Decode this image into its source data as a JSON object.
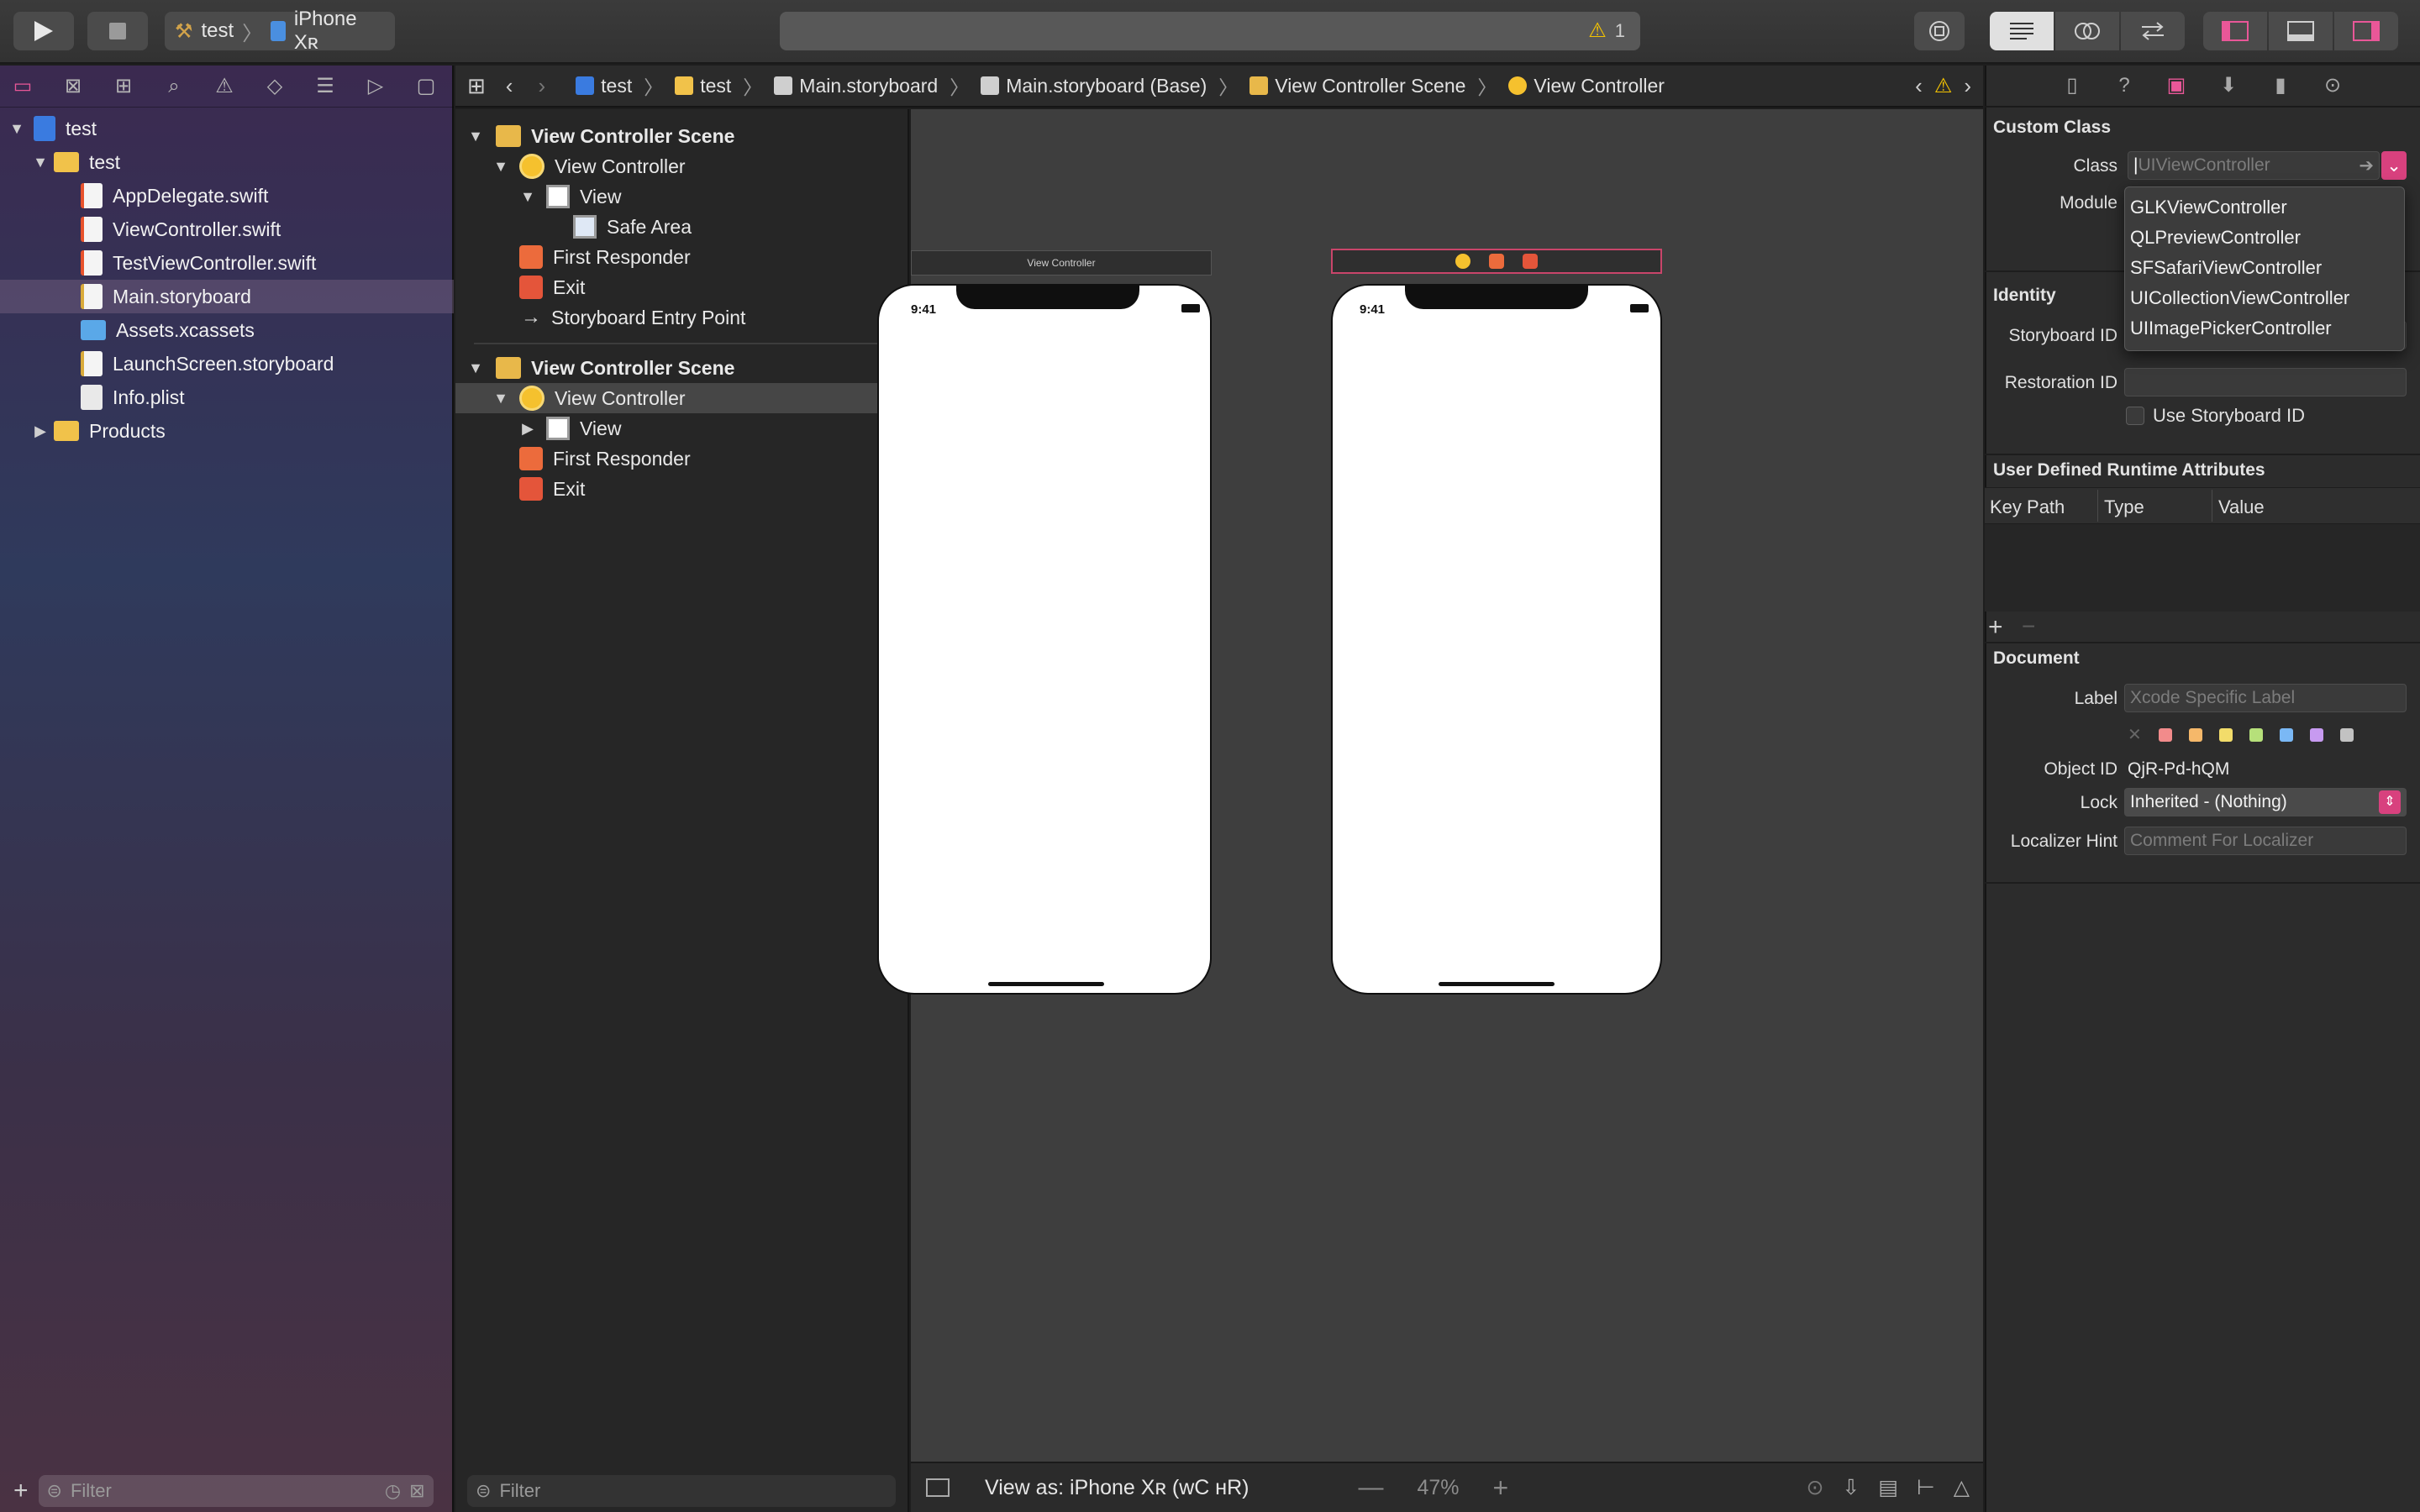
{
  "toolbar": {
    "scheme_name": "test",
    "device_name": "iPhone Xʀ",
    "warning_count": "1"
  },
  "navigator": {
    "items": [
      {
        "label": "test",
        "icon": "project-icon"
      },
      {
        "label": "test",
        "icon": "folder-icon"
      },
      {
        "label": "AppDelegate.swift",
        "icon": "swift-file-icon"
      },
      {
        "label": "ViewController.swift",
        "icon": "swift-file-icon"
      },
      {
        "label": "TestViewController.swift",
        "icon": "swift-file-icon"
      },
      {
        "label": "Main.storyboard",
        "icon": "storyboard-file-icon"
      },
      {
        "label": "Assets.xcassets",
        "icon": "assets-folder-icon"
      },
      {
        "label": "LaunchScreen.storyboard",
        "icon": "storyboard-file-icon"
      },
      {
        "label": "Info.plist",
        "icon": "plist-file-icon"
      },
      {
        "label": "Products",
        "icon": "folder-icon"
      }
    ],
    "filter_placeholder": "Filter"
  },
  "jumpbar": {
    "crumbs": [
      "test",
      "test",
      "Main.storyboard",
      "Main.storyboard (Base)",
      "View Controller Scene",
      "View Controller"
    ]
  },
  "outline": {
    "scene1": {
      "title": "View Controller Scene",
      "vc": "View Controller",
      "view": "View",
      "safe_area": "Safe Area",
      "first_responder": "First Responder",
      "exit": "Exit",
      "entry_point": "Storyboard Entry Point"
    },
    "scene2": {
      "title": "View Controller Scene",
      "vc": "View Controller",
      "view": "View",
      "first_responder": "First Responder",
      "exit": "Exit"
    },
    "filter_placeholder": "Filter"
  },
  "canvas": {
    "scene1_title": "View Controller",
    "phone_time": "9:41",
    "view_as": "View as: iPhone Xʀ (ᴡC ʜR)",
    "zoom": "47%"
  },
  "inspector": {
    "custom_class": {
      "title": "Custom Class",
      "class_label": "Class",
      "class_placeholder": "UIViewController",
      "module_label": "Module",
      "dropdown_options": [
        "GLKViewController",
        "QLPreviewController",
        "SFSafariViewController",
        "UICollectionViewController",
        "UIImagePickerController"
      ]
    },
    "identity": {
      "title": "Identity",
      "storyboard_id_label": "Storyboard ID",
      "restoration_id_label": "Restoration ID",
      "use_storyboard_id": "Use Storyboard ID"
    },
    "runtime_attrs": {
      "title": "User Defined Runtime Attributes",
      "col_key_path": "Key Path",
      "col_type": "Type",
      "col_value": "Value"
    },
    "document": {
      "title": "Document",
      "label_label": "Label",
      "label_placeholder": "Xcode Specific Label",
      "object_id_label": "Object ID",
      "object_id_value": "QjR-Pd-hQM",
      "lock_label": "Lock",
      "lock_value": "Inherited - (Nothing)",
      "localizer_label": "Localizer Hint",
      "localizer_placeholder": "Comment For Localizer",
      "swatch_colors": [
        "#f28b8b",
        "#f5b86a",
        "#f2dc6a",
        "#b6e07a",
        "#7ab8f5",
        "#c79af0",
        "#c2c2c2"
      ]
    }
  },
  "colors": {
    "accent_pink": "#e95798",
    "warning_yellow": "#f5c400"
  }
}
